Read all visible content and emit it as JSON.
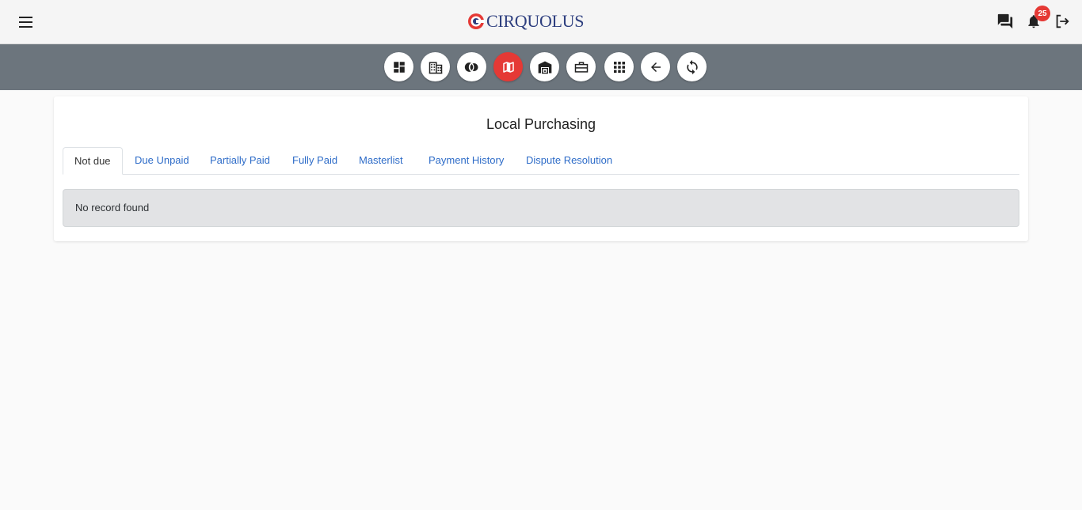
{
  "header": {
    "logo_text": "CIRQUOLUS",
    "notification_count": "25",
    "icons": [
      "menu-icon",
      "chat-icon",
      "bell-icon",
      "logout-icon"
    ]
  },
  "toolbar": {
    "buttons": [
      {
        "name": "dashboard",
        "icon": "dashboard-icon",
        "active": false
      },
      {
        "name": "company",
        "icon": "building-icon",
        "active": false
      },
      {
        "name": "cards",
        "icon": "toggle-circles-icon",
        "active": false
      },
      {
        "name": "map",
        "icon": "map-icon",
        "active": true
      },
      {
        "name": "warehouse",
        "icon": "warehouse-icon",
        "active": false
      },
      {
        "name": "business",
        "icon": "briefcase-icon",
        "active": false
      },
      {
        "name": "apps",
        "icon": "apps-grid-icon",
        "active": false
      },
      {
        "name": "back",
        "icon": "arrow-left-icon",
        "active": false
      },
      {
        "name": "refresh",
        "icon": "sync-icon",
        "active": false
      }
    ]
  },
  "page": {
    "title": "Local Purchasing",
    "tabs": [
      {
        "label": "Not due",
        "active": true
      },
      {
        "label": "Due Unpaid",
        "active": false
      },
      {
        "label": "Partially Paid",
        "active": false
      },
      {
        "label": "Fully Paid",
        "active": false
      },
      {
        "label": "Masterlist",
        "active": false
      },
      {
        "label": "Payment History",
        "active": false
      },
      {
        "label": "Dispute Resolution",
        "active": false
      }
    ],
    "empty_message": "No record found"
  },
  "colors": {
    "accent": "#e53935",
    "toolbar_bg": "#6c757d",
    "link": "#2e6cc8",
    "brand": "#2e3f7f"
  }
}
